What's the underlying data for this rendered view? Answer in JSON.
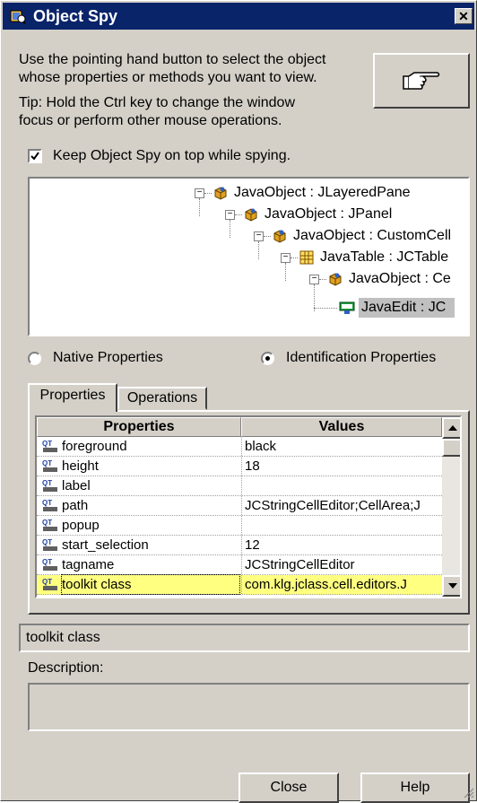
{
  "window": {
    "title": "Object Spy",
    "close_glyph": "✕"
  },
  "instructions": {
    "line1": "Use the pointing hand button to select the object",
    "line2": "whose properties or methods you want to view.",
    "tip1": "Tip: Hold the Ctrl key to change the window",
    "tip2": "focus or perform other mouse operations."
  },
  "pointer_button": {
    "icon": "pointing-hand-icon"
  },
  "keep_on_top": {
    "label": "Keep Object Spy on top while spying.",
    "checked": true
  },
  "tree": {
    "nodes": [
      {
        "label": "JavaObject : JLayeredPane",
        "icon": "java-object-icon"
      },
      {
        "label": "JavaObject : JPanel",
        "icon": "java-object-icon"
      },
      {
        "label": "JavaObject : CustomCell",
        "icon": "java-object-icon"
      },
      {
        "label": "JavaTable : JCTable",
        "icon": "java-table-icon"
      },
      {
        "label": "JavaObject : Ce",
        "icon": "java-object-icon"
      },
      {
        "label": "JavaEdit : JC",
        "icon": "java-edit-icon",
        "selected": true
      }
    ]
  },
  "property_mode": {
    "native": "Native Properties",
    "identification": "Identification Properties",
    "selected": "identification"
  },
  "tabs": [
    {
      "label": "Properties",
      "active": true
    },
    {
      "label": "Operations",
      "active": false
    }
  ],
  "grid": {
    "columns": [
      "Properties",
      "Values"
    ],
    "rows": [
      {
        "property": "foreground",
        "value": "black"
      },
      {
        "property": "height",
        "value": "18"
      },
      {
        "property": "label",
        "value": ""
      },
      {
        "property": "path",
        "value": "JCStringCellEditor;CellArea;J"
      },
      {
        "property": "popup",
        "value": ""
      },
      {
        "property": "start_selection",
        "value": "12"
      },
      {
        "property": "tagname",
        "value": "JCStringCellEditor"
      },
      {
        "property": "toolkit class",
        "value": "com.klg.jclass.cell.editors.J",
        "selected": true
      }
    ],
    "row_icon": "qtp-property-icon"
  },
  "selected_property": "toolkit class",
  "description": {
    "label": "Description:",
    "value": ""
  },
  "buttons": {
    "close": "Close",
    "help": "Help"
  },
  "colors": {
    "title_bar": "#0a246a",
    "dialog": "#d4d0c8",
    "highlight": "#ffff80",
    "tree_selection": "#c0c0c0"
  }
}
